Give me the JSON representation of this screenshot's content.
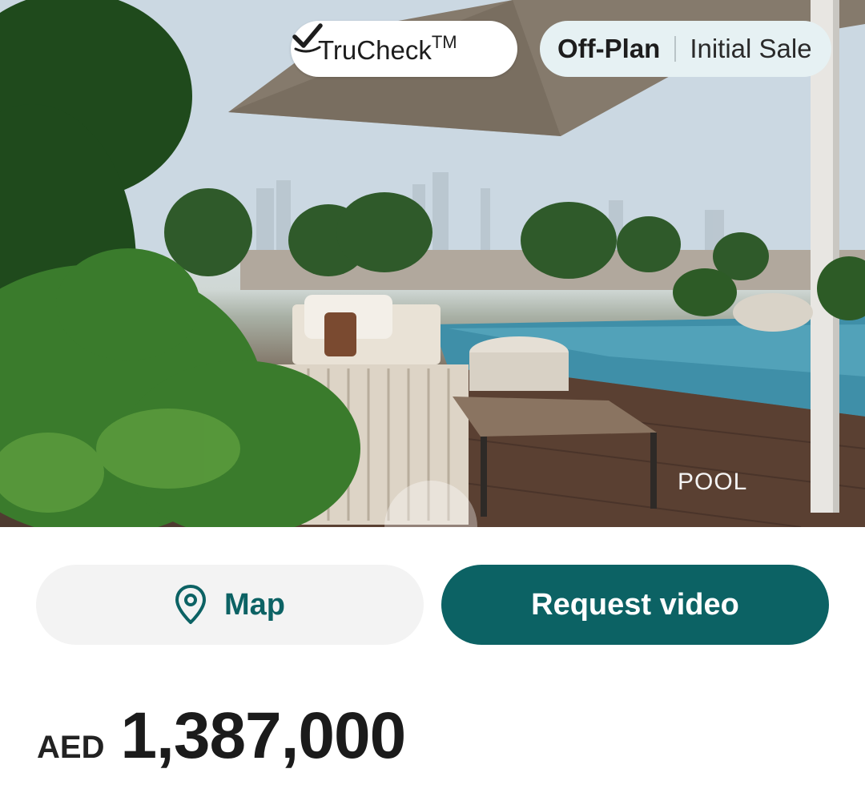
{
  "hero": {
    "badges": {
      "trucheck": {
        "label": "TruCheck",
        "tm": "TM",
        "icon": "verified-check-icon"
      },
      "offplan": {
        "primary": "Off-Plan",
        "secondary": "Initial Sale"
      }
    },
    "image_caption": "POOL"
  },
  "actions": {
    "map_label": "Map",
    "map_icon": "location-pin-icon",
    "request_video_label": "Request video"
  },
  "price": {
    "currency": "AED",
    "amount": "1,387,000"
  },
  "colors": {
    "accent": "#0c6264",
    "map_button_bg": "#f3f3f3",
    "offplan_badge_bg": "#e6f1f3"
  }
}
